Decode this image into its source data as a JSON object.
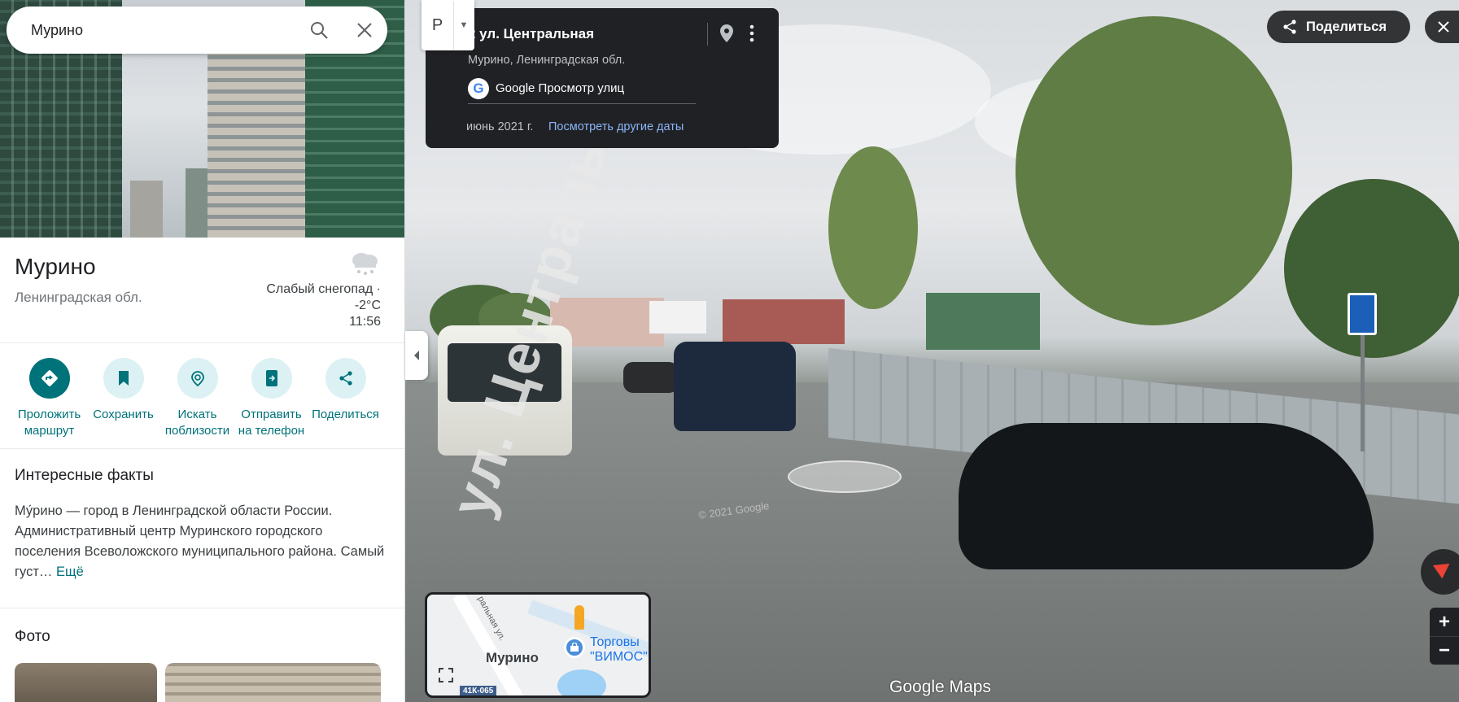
{
  "search": {
    "value": "Мурино",
    "search_icon": "search-icon",
    "close_icon": "close-icon"
  },
  "place": {
    "name": "Мурино",
    "region": "Ленинградская обл.",
    "weather": {
      "condition": "Слабый снегопад ·",
      "temperature": "-2°C",
      "time": "11:56",
      "icon": "snow-cloud-icon"
    }
  },
  "actions": [
    {
      "label_line1": "Проложить",
      "label_line2": "маршрут",
      "icon": "directions-icon"
    },
    {
      "label_line1": "Сохранить",
      "label_line2": "",
      "icon": "bookmark-icon"
    },
    {
      "label_line1": "Искать",
      "label_line2": "поблизости",
      "icon": "nearby-search-icon"
    },
    {
      "label_line1": "Отправить",
      "label_line2": "на телефон",
      "icon": "send-to-phone-icon"
    },
    {
      "label_line1": "Поделиться",
      "label_line2": "",
      "icon": "share-icon"
    }
  ],
  "facts": {
    "title": "Интересные факты",
    "text": "Му́рино — город в Ленинградской области России. Административный центр Муринского городского поселения Всеволожского муниципального района. Самый густ…",
    "more_label": "Ещё"
  },
  "photos": {
    "title": "Фото"
  },
  "street_view": {
    "pegman_label": "Р",
    "address": "2 ул. Центральная",
    "locality": "Мурино, Ленинградская обл.",
    "brand": "Google Просмотр улиц",
    "brand_logo_letter": "G",
    "date": "июнь 2021 г.",
    "other_dates_label": "Посмотреть другие даты",
    "share_label": "Поделиться",
    "road_marking": "ул. Центральная",
    "watermark": "© 2021 Google",
    "zoom_in": "+",
    "zoom_out": "−",
    "footer_logo": "Google Maps"
  },
  "mini_map": {
    "city": "Мурино",
    "street": "ральная ул.",
    "poi": "Торговы\n\"ВИМОС\"",
    "road_badge": "41К-065"
  },
  "colors": {
    "accent": "#00727a",
    "action_bg": "#dcf1f3",
    "card_bg": "#202124",
    "link_blue": "#8ab4f8"
  }
}
